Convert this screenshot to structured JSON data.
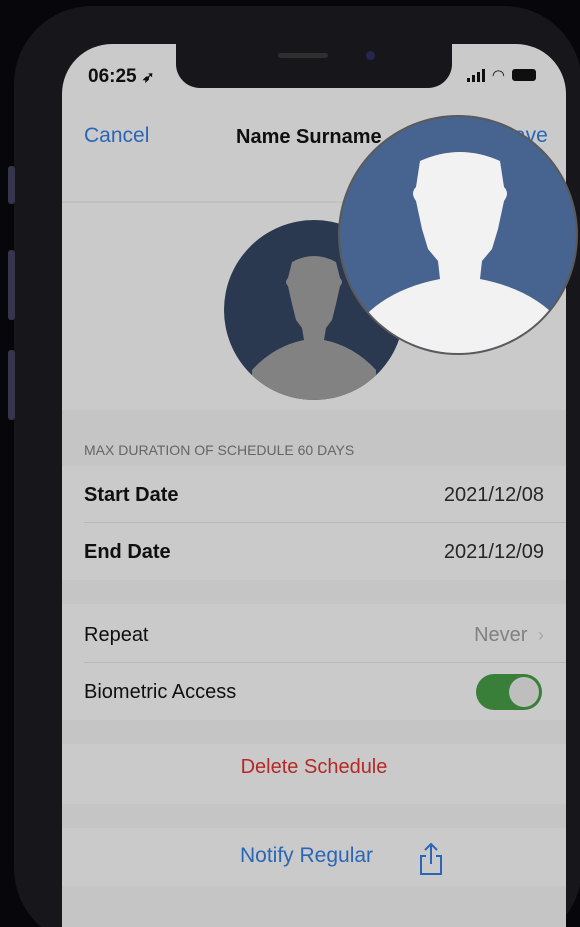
{
  "status_bar": {
    "time": "06:25",
    "location_icon": "location-arrow-icon",
    "signal_icon": "signal-icon",
    "wifi_icon": "wifi-icon",
    "battery_icon": "battery-icon"
  },
  "nav": {
    "cancel_label": "Cancel",
    "title": "Name Surname",
    "save_label": "Save"
  },
  "schedule": {
    "header": "MAX DURATION OF SCHEDULE 60 DAYS",
    "start_label": "Start Date",
    "start_value": "2021/12/08",
    "end_label": "End Date",
    "end_value": "2021/12/09"
  },
  "options": {
    "repeat_label": "Repeat",
    "repeat_value": "Never",
    "biometric_label": "Biometric Access",
    "biometric_enabled": true
  },
  "actions": {
    "delete_label": "Delete Schedule",
    "notify_label": "Notify Regular",
    "share_icon": "share-icon"
  },
  "colors": {
    "accent": "#2e6fc6",
    "destructive": "#c42c2c",
    "toggle_on": "#3e8a3e",
    "avatar_bg": "#2e3d57",
    "avatar_zoom_bg": "#46648f"
  }
}
